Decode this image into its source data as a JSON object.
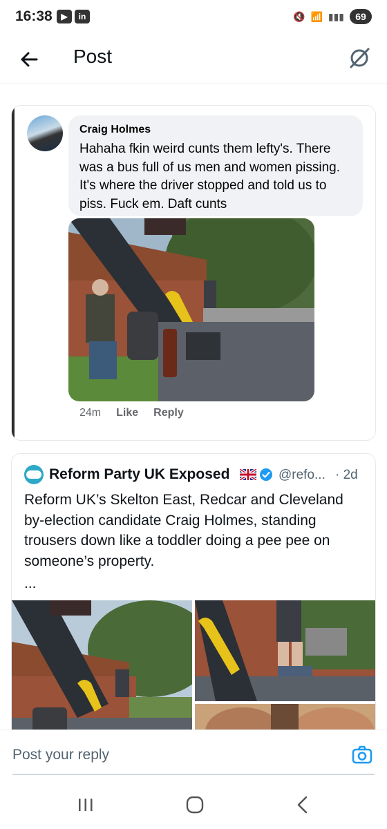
{
  "status_bar": {
    "time": "16:38",
    "notif_icons": [
      "play-icon",
      "linkedin-icon"
    ],
    "battery": "69"
  },
  "header": {
    "title": "Post"
  },
  "fb_comment": {
    "author": "Craig Holmes",
    "text": "Hahaha fkin weird cunts them lefty's. There was a bus full of us men and women pissing. It's where the driver stopped and told us to piss. Fuck em. Daft cunts",
    "time": "24m",
    "like_label": "Like",
    "reply_label": "Reply"
  },
  "quote": {
    "name": "Reform Party UK Exposed",
    "handle": "@refo...",
    "time": "· 2d",
    "text": "Reform UK’s Skelton East, Redcar and Cleveland by-election candidate Craig Holmes, standing trousers down like a toddler doing a pee pee on someone’s property.",
    "ellipsis": "..."
  },
  "reply": {
    "placeholder": "Post your reply"
  },
  "colors": {
    "accent": "#1d9bf0",
    "fb_bubble": "#f0f2f5",
    "muted": "#536471"
  }
}
